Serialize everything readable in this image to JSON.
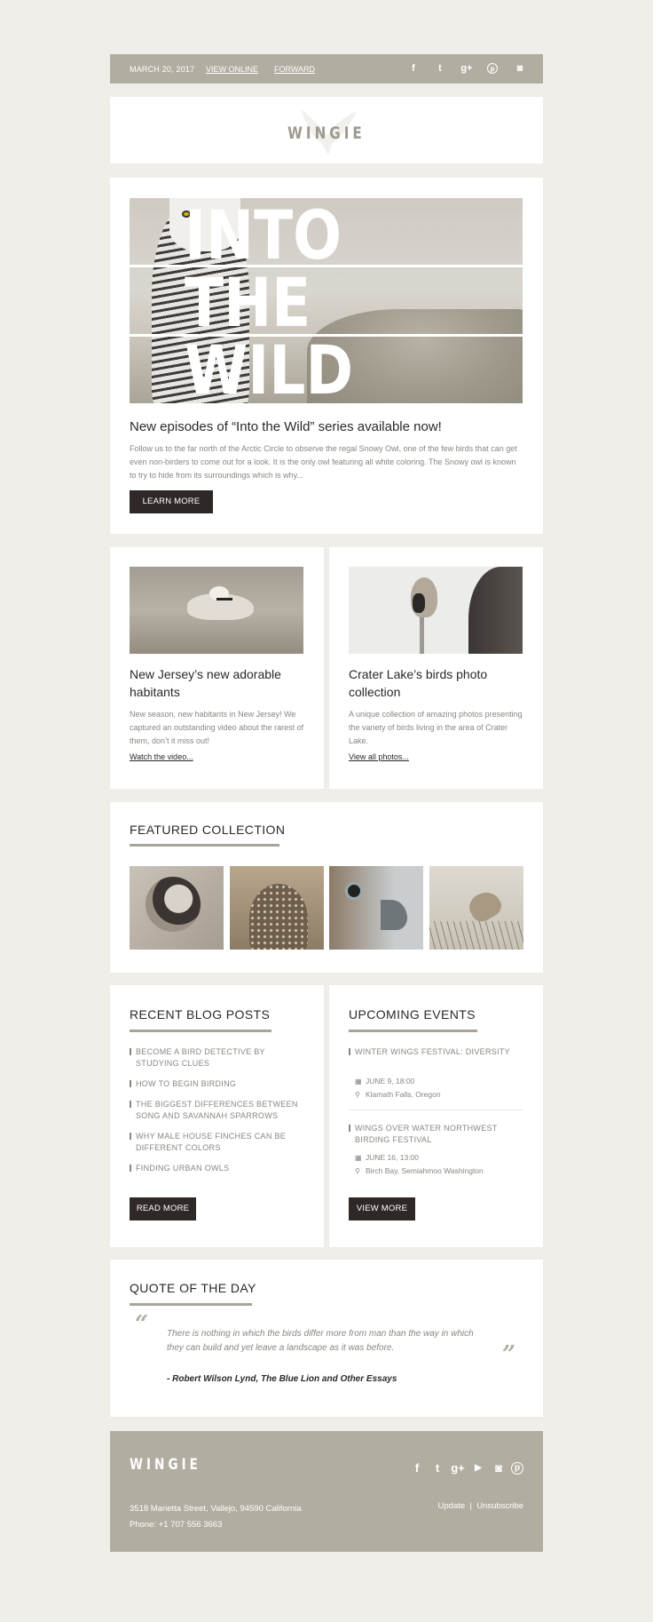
{
  "topbar": {
    "date": "MARCH 20, 2017",
    "view_online": "VIEW ONLINE",
    "forward": "FORWARD",
    "social": [
      {
        "name": "facebook-icon",
        "glyph": "f"
      },
      {
        "name": "twitter-icon",
        "glyph": "t"
      },
      {
        "name": "google-plus-icon",
        "glyph": "g+"
      },
      {
        "name": "pinterest-icon",
        "glyph": "p"
      },
      {
        "name": "instagram-icon",
        "glyph": "◙"
      }
    ]
  },
  "brand": {
    "logo": "WINGIE"
  },
  "hero": {
    "image_words": [
      "INTO",
      "THE",
      "WILD"
    ],
    "title": "New episodes of “Into the Wild” series available now!",
    "body": "Follow us to the far north of the Arctic Circle  to observe the regal Snowy Owl, one of the few birds that can get even non-birders to come out for a look. It is the only owl featuring all white coloring. The Snowy owl is known to try to hide from its surroundings which is why...",
    "button": "LEARN MORE"
  },
  "articles": [
    {
      "title": "New Jersey’s new adorable habitants",
      "body": "New season, new habitants in New Jersey! We captured an outstanding video about the rarest of them, don’t it miss out!",
      "link": "Watch the video..."
    },
    {
      "title": "Crater Lake’s birds photo collection",
      "body": "A unique collection of amazing photos presenting the variety of birds living in the area of  Crater Lake.",
      "link": "View all photos..."
    }
  ],
  "featured": {
    "title": "FEATURED COLLECTION",
    "photos": [
      "house sparrow",
      "burrowing owl",
      "falcon head",
      "sparrow on branch"
    ]
  },
  "blog": {
    "title": "RECENT BLOG POSTS",
    "posts": [
      "BECOME A BIRD DETECTIVE BY STUDYING CLUES",
      "HOW TO BEGIN BIRDING",
      "THE BIGGEST DIFFERENCES BETWEEN SONG AND SAVANNAH SPARROWS",
      "WHY MALE HOUSE FINCHES CAN BE DIFFERENT COLORS",
      "FINDING URBAN OWLS"
    ],
    "button": "READ MORE"
  },
  "events": {
    "title": "UPCOMING EVENTS",
    "items": [
      {
        "name": "WINTER WINGS FESTIVAL: DIVERSITY",
        "date": "JUNE 9, 18:00",
        "location": "Klamath Falls, Oregon"
      },
      {
        "name": "WINGS OVER WATER NORTHWEST BIRDING FESTIVAL",
        "date": "JUNE 16, 13:00",
        "location": "Birch Bay, Semiahmoo Washington"
      }
    ],
    "button": "VIEW MORE"
  },
  "quote": {
    "title": "QUOTE OF THE DAY",
    "open_mark": "“",
    "close_mark": "”",
    "text": "There is nothing in which the birds differ more from man than the way in which they can build and yet leave a landscape as it was before.",
    "author": "- Robert Wilson Lynd, The Blue Lion and Other Essays"
  },
  "footer": {
    "logo": "WINGIE",
    "social": [
      {
        "name": "facebook-icon",
        "glyph": "f"
      },
      {
        "name": "twitter-icon",
        "glyph": "t"
      },
      {
        "name": "google-plus-icon",
        "glyph": "g+"
      },
      {
        "name": "youtube-icon",
        "glyph": "▶"
      },
      {
        "name": "instagram-icon",
        "glyph": "◙"
      },
      {
        "name": "pinterest-icon",
        "glyph": "p"
      }
    ],
    "address": "3518 Marietta Street, Vallejo, 94590 California",
    "phone": "Phone: +1 707 556 3663",
    "update": "Update",
    "separator": "|",
    "unsubscribe": "Unsubscribe"
  },
  "colors": {
    "background": "#efeee9",
    "accent": "#b2ada1",
    "button": "#2e2926",
    "text_dark": "#2c2826",
    "text_muted": "#8a8680"
  }
}
